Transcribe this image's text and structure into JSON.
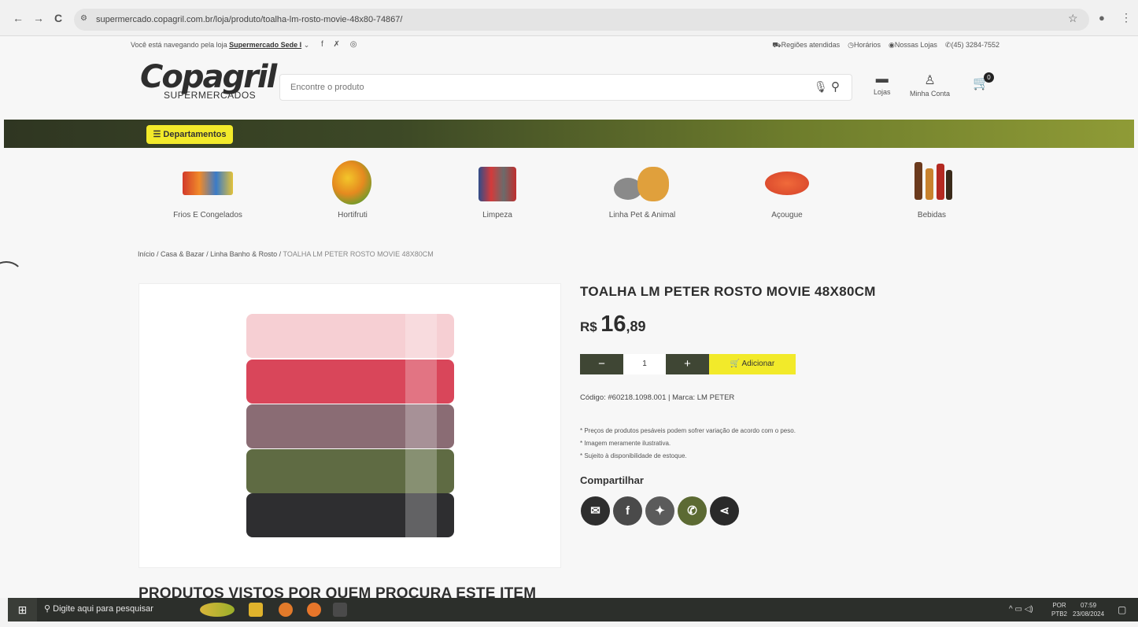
{
  "browser": {
    "url": "supermercado.copagril.com.br/loja/produto/toalha-lm-rosto-movie-48x80-74867/",
    "back": "←",
    "forward": "→",
    "reload": "C",
    "star": "☆",
    "menu": "⋮"
  },
  "topbar": {
    "store_prefix": "Você está navegando pela loja",
    "store_name": "Supermercado Sede I",
    "social": "f ✗ ◎",
    "links": [
      "Regiões atendidas",
      "Horários",
      "Nossas Lojas",
      "(45) 3284-7552"
    ]
  },
  "header": {
    "logo_main": "Copagril",
    "logo_sub": "SUPERMERCADOS",
    "search_placeholder": "Encontre o produto",
    "stores_label": "Lojas",
    "account_label": "Minha Conta",
    "cart_count": "0"
  },
  "nav": {
    "departments_label": "Departamentos"
  },
  "categories": [
    {
      "label": "Frios E Congelados"
    },
    {
      "label": "Hortifruti"
    },
    {
      "label": "Limpeza"
    },
    {
      "label": "Linha Pet & Animal"
    },
    {
      "label": "Açougue"
    },
    {
      "label": "Bebidas"
    }
  ],
  "breadcrumb": {
    "items": [
      "Início",
      "Casa & Bazar",
      "Linha Banho & Rosto"
    ],
    "current": "TOALHA LM PETER ROSTO MOVIE 48X80CM"
  },
  "product": {
    "title": "TOALHA LM PETER ROSTO MOVIE 48X80CM",
    "price_currency": "R$",
    "price_int": "16",
    "price_dec": ",89",
    "qty": "1",
    "minus": "−",
    "plus": "+",
    "add_label": "Adicionar",
    "code_line": "Código: #60218.1098.001 | Marca: LM PETER",
    "notes": [
      "* Preços de produtos pesáveis podem sofrer variação de acordo com o peso.",
      "* Imagem meramente ilustrativa.",
      "* Sujeito à disponibilidade de estoque."
    ],
    "share_heading": "Compartilhar",
    "towel_colors": [
      "#f6cfd3",
      "#d9465a",
      "#8a6c74",
      "#5f6b43",
      "#2e2e30"
    ]
  },
  "section": {
    "seen_title": "PRODUTOS VISTOS POR QUEM PROCURA ESTE ITEM"
  },
  "taskbar": {
    "search_placeholder": "Digite aqui para pesquisar",
    "lang": "POR",
    "lang2": "PTB2",
    "time": "07:59",
    "date": "23/08/2024"
  }
}
